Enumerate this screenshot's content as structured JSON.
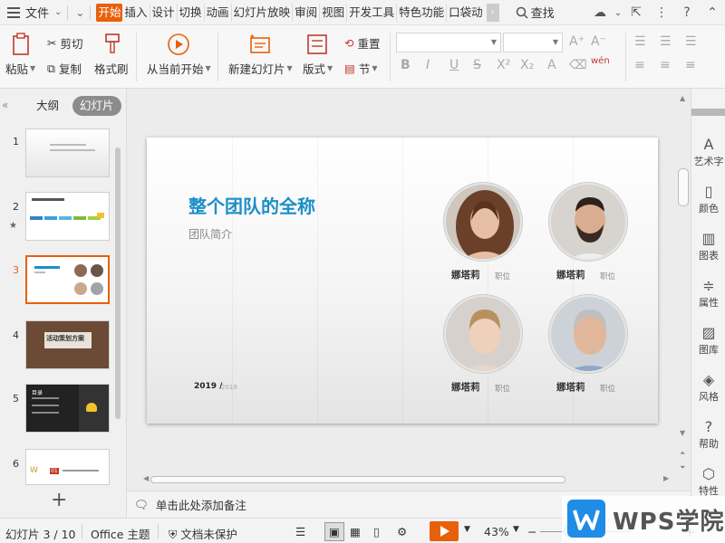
{
  "menubar": {
    "file_label": "文件",
    "tabs": [
      "开始",
      "插入",
      "设计",
      "切换",
      "动画",
      "幻灯片放映",
      "审阅",
      "视图",
      "开发工具",
      "特色功能",
      "口袋动"
    ],
    "active_tab": "开始",
    "search_label": "查找"
  },
  "ribbon": {
    "paste": "粘贴",
    "cut": "剪切",
    "copy": "复制",
    "format_painter": "格式刷",
    "from_current": "从当前开始",
    "new_slide": "新建幻灯片",
    "layout": "版式",
    "reset": "重置",
    "section": "节",
    "phonetic": "wén"
  },
  "left_panel": {
    "tab_outline": "大纲",
    "tab_slides": "幻灯片",
    "slide_numbers": [
      "1",
      "2",
      "3",
      "4",
      "5",
      "6"
    ],
    "thumb4_title": "活动策划方案",
    "thumb5_title": "目录",
    "thumb6_text": "01"
  },
  "slide": {
    "title": "整个团队的全称",
    "subtitle": "团队简介",
    "year": "2019 /",
    "year2": "2018",
    "members": [
      {
        "name": "娜塔莉",
        "role": "职位"
      },
      {
        "name": "娜塔莉",
        "role": "职位"
      },
      {
        "name": "娜塔莉",
        "role": "职位"
      },
      {
        "name": "娜塔莉",
        "role": "职位"
      }
    ]
  },
  "notes": {
    "placeholder": "单击此处添加备注"
  },
  "right_panel": {
    "items": [
      "艺术字",
      "颜色",
      "图表",
      "属性",
      "图库",
      "风格",
      "帮助",
      "特性"
    ]
  },
  "statusbar": {
    "slide_info": "幻灯片 3 / 10",
    "theme": "Office 主题",
    "protection": "文档未保护",
    "zoom": "43%"
  },
  "watermark": {
    "text": "WPS学院"
  },
  "colors": {
    "accent": "#e8600a",
    "title_blue": "#1b8fc7",
    "wps_blue": "#1f8ce6"
  }
}
